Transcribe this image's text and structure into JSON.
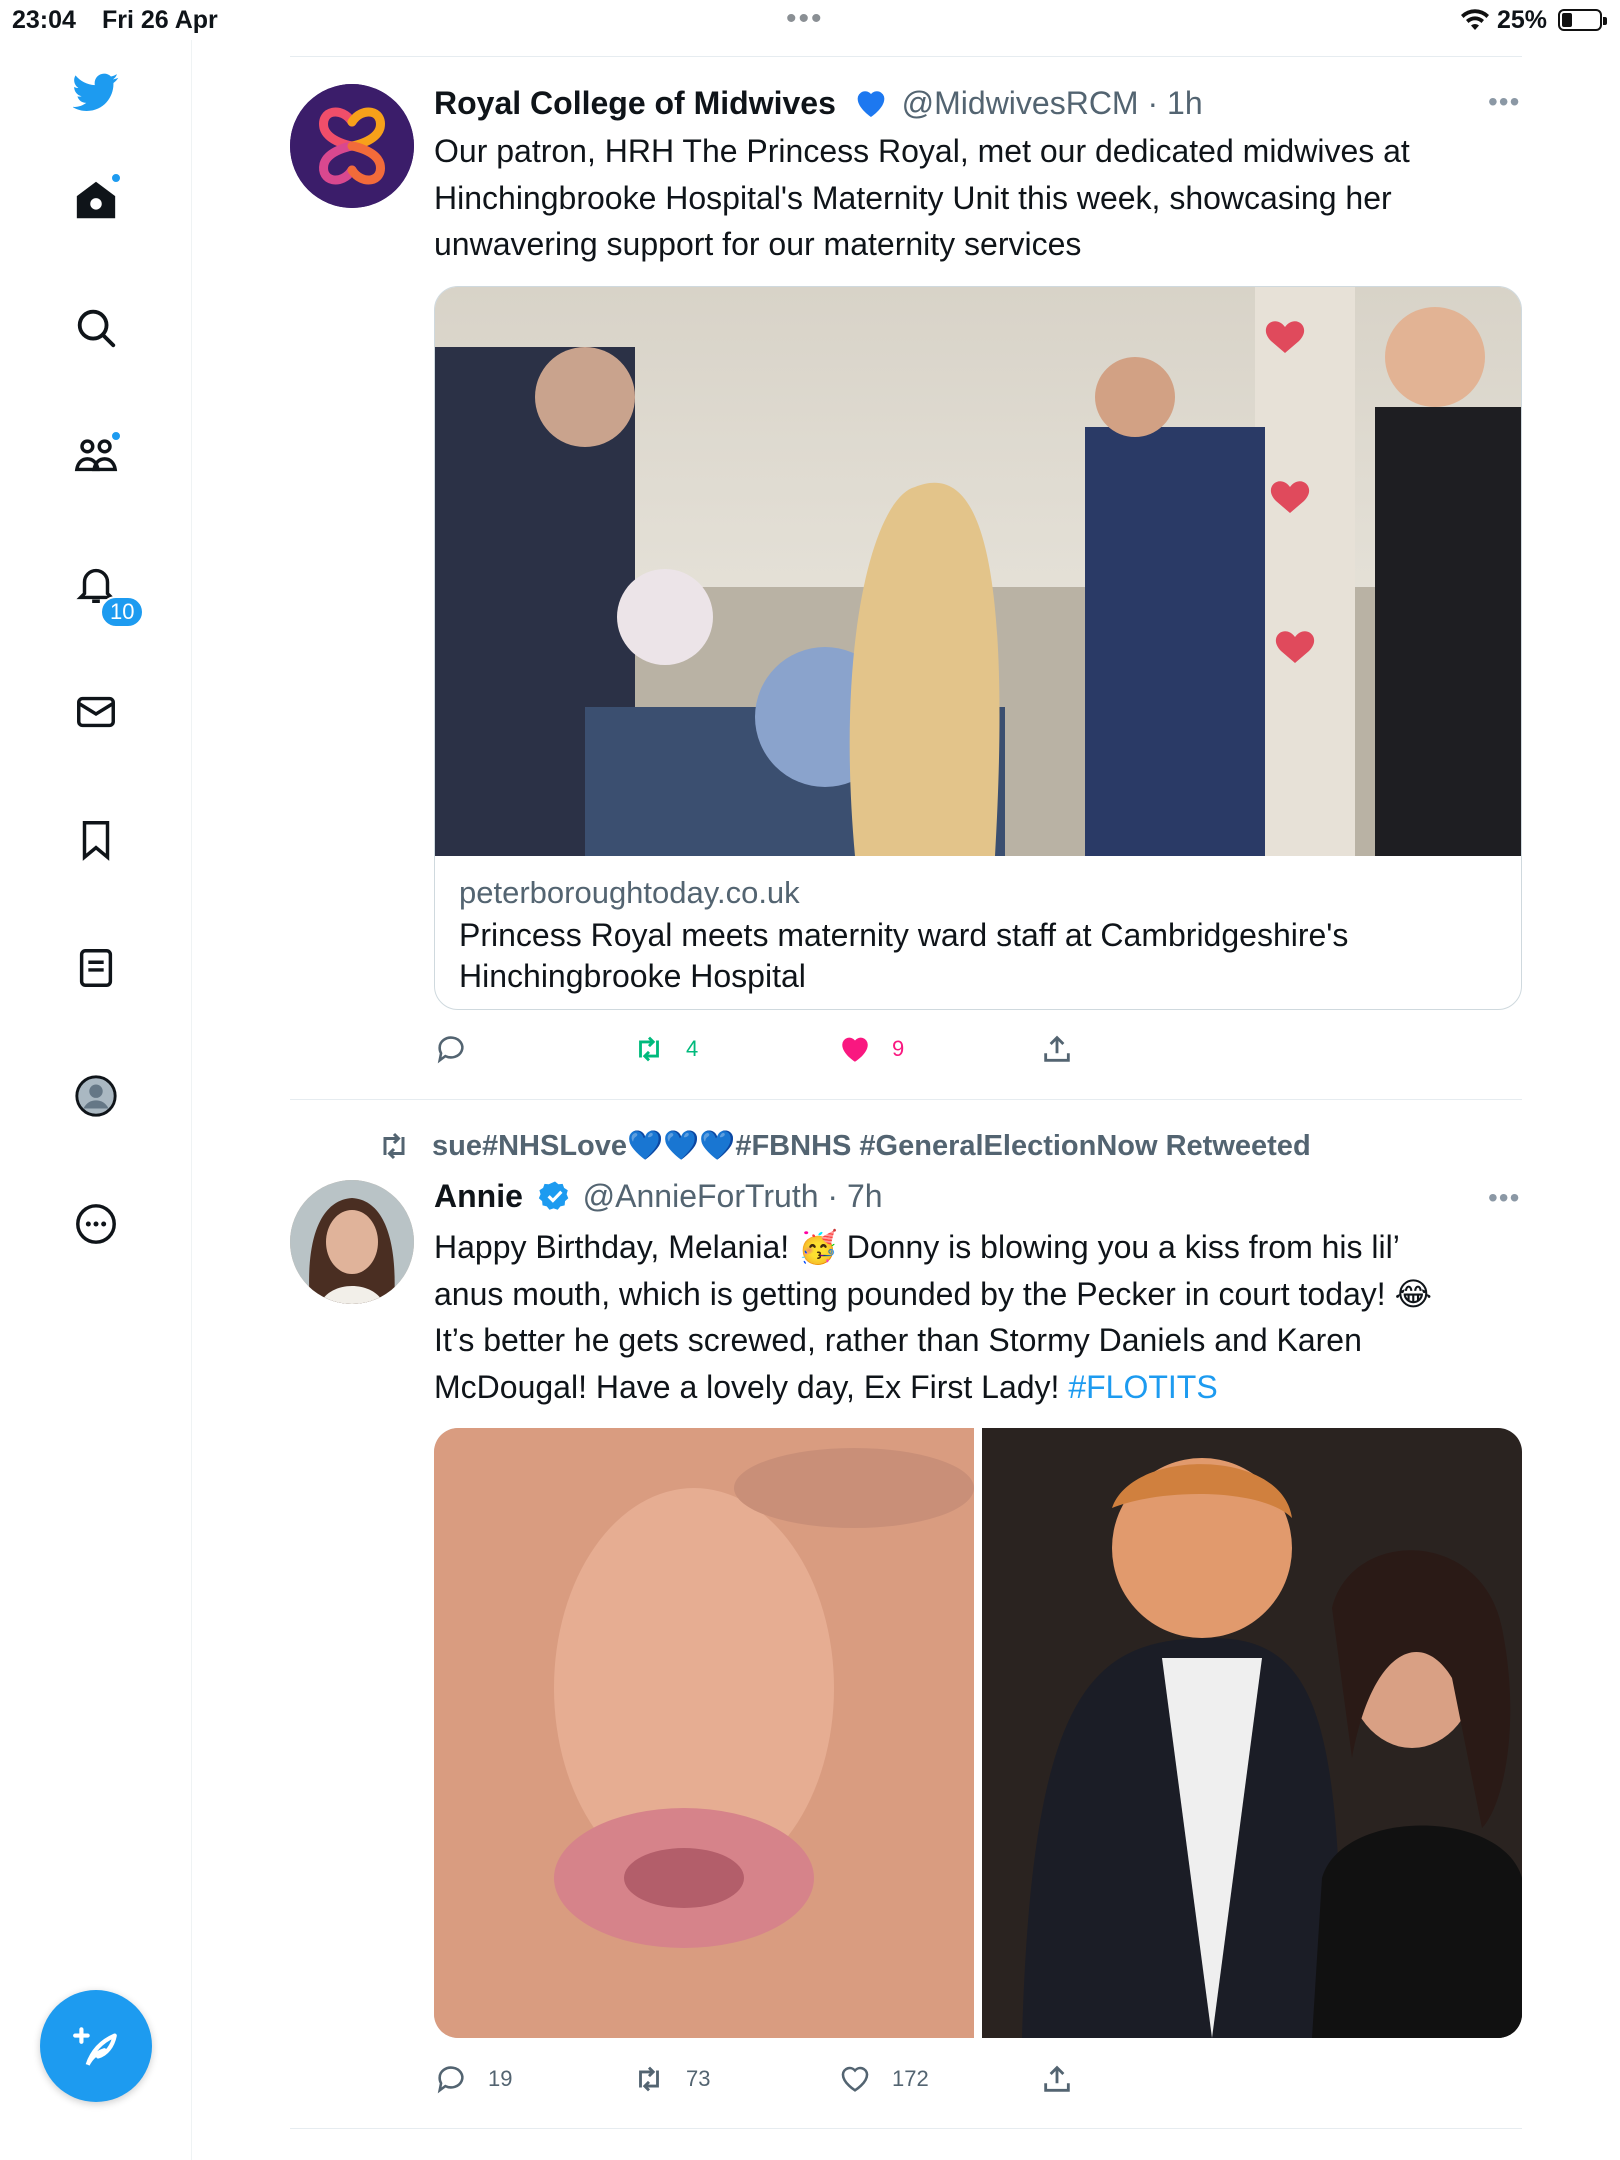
{
  "status_bar": {
    "time": "23:04",
    "date": "Fri 26 Apr",
    "battery": "25%",
    "battery_level": 0.25
  },
  "sidebar": {
    "items": [
      {
        "name": "twitter-logo",
        "icon": "bird-icon"
      },
      {
        "name": "home",
        "icon": "home-icon",
        "has_dot": true
      },
      {
        "name": "explore",
        "icon": "search-icon"
      },
      {
        "name": "communities",
        "icon": "people-icon",
        "has_dot": true
      },
      {
        "name": "notifications",
        "icon": "bell-icon",
        "badge": "10"
      },
      {
        "name": "messages",
        "icon": "envelope-icon"
      },
      {
        "name": "bookmarks",
        "icon": "bookmark-icon"
      },
      {
        "name": "lists",
        "icon": "list-icon"
      },
      {
        "name": "profile",
        "icon": "profile-icon"
      },
      {
        "name": "more",
        "icon": "more-circle-icon"
      }
    ],
    "notif_badge": "10"
  },
  "tweets": [
    {
      "name": "Royal College of Midwives",
      "verified": true,
      "verified_color": "#1d9bf0",
      "handle": "@MidwivesRCM",
      "time": "· 1h",
      "text_lines": [
        "Our patron, HRH The Princess Royal, met our dedicated midwives at",
        "Hinchingbrooke Hospital's Maternity Unit this week, showcasing her",
        "unwavering support for our maternity services"
      ],
      "card": {
        "domain": "peterboroughtoday.co.uk",
        "title": "Princess Royal meets maternity ward staff at Cambridgeshire's Hinchingbrooke Hospital"
      },
      "actions": {
        "reply": "",
        "retweet": "4",
        "like": "9",
        "liked": true
      }
    },
    {
      "retweet_context": "sue#NHSLove💙💙💙#FBNHS #GeneralElectionNow Retweeted",
      "name": "Annie",
      "verified": true,
      "handle": "@AnnieForTruth",
      "time": "· 7h",
      "text": {
        "line1": "Happy Birthday, Melania! 🥳 Donny is blowing you a kiss from his lil’",
        "line2": "anus mouth, which is getting pounded by the Pecker in court today! 😂",
        "line3": "It’s better he gets screwed, rather than Stormy Daniels and Karen",
        "line4": "McDougal! Have a lovely day, Ex First Lady! ",
        "hashtag": "#FLOTITS"
      },
      "actions": {
        "reply": "19",
        "retweet": "73",
        "like": "172",
        "liked": false
      }
    }
  ],
  "colors": {
    "accent": "#1d9bf0",
    "retweet_green": "#00ba7c",
    "like_pink": "#f91880",
    "muted": "#536471"
  }
}
